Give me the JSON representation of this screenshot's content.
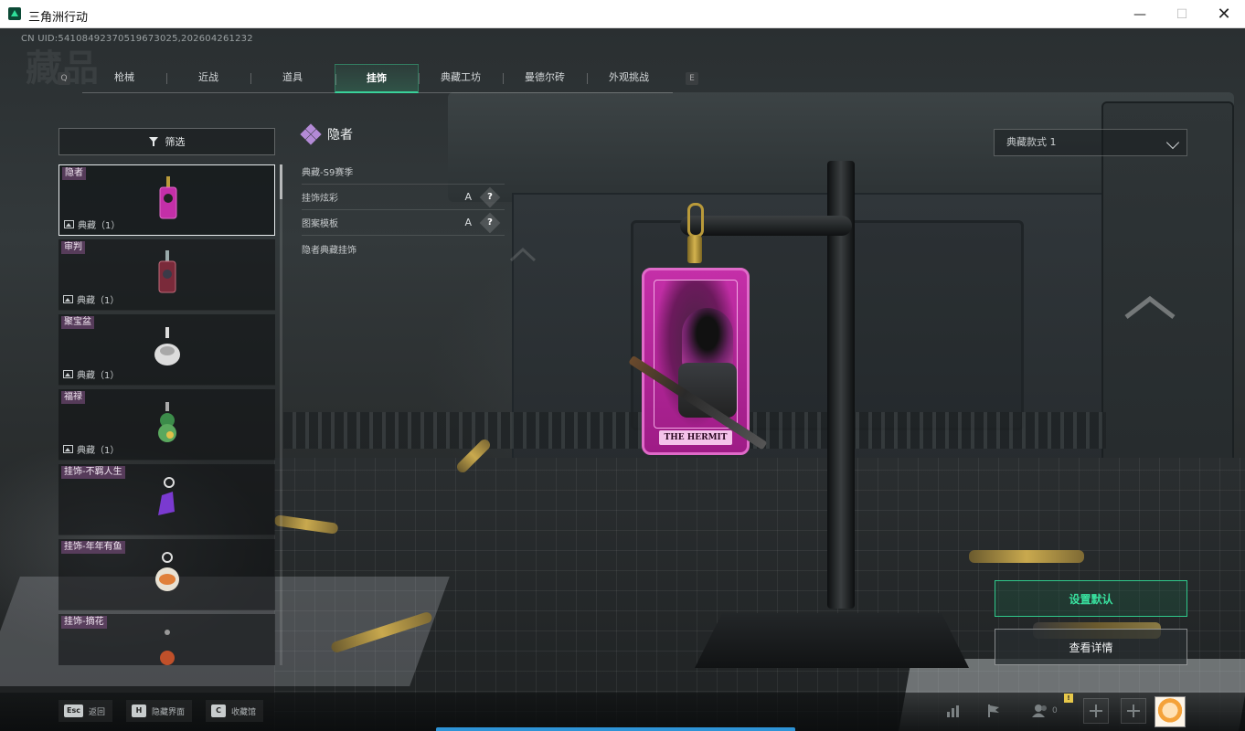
{
  "window": {
    "title": "三角洲行动",
    "minimize_glyph": "—",
    "maximize_glyph": "☐",
    "close_glyph": "✕"
  },
  "header": {
    "uid_text": "CN UID:5410849237051967302​5,202604261232",
    "watermark": "藏品",
    "key_prev": "Q",
    "key_next": "E"
  },
  "tabs": [
    {
      "label": "枪械",
      "active": false
    },
    {
      "label": "近战",
      "active": false
    },
    {
      "label": "道具",
      "active": false
    },
    {
      "label": "挂饰",
      "active": true
    },
    {
      "label": "典藏工坊",
      "active": false
    },
    {
      "label": "曼德尔砖",
      "active": false
    },
    {
      "label": "外观挑战",
      "active": false
    }
  ],
  "filter": {
    "label": "筛选",
    "icon": "filter-icon"
  },
  "items": [
    {
      "name": "隐者",
      "footer": "典藏（1）",
      "selected": true,
      "thumb_color": "#c42fa8"
    },
    {
      "name": "审判",
      "footer": "典藏（1）",
      "selected": false,
      "thumb_color": "#7a2a3a"
    },
    {
      "name": "聚宝盆",
      "footer": "典藏（1）",
      "selected": false,
      "thumb_color": "#d9d9d9"
    },
    {
      "name": "福禄",
      "footer": "典藏（1）",
      "selected": false,
      "thumb_color": "#3c8c4a"
    },
    {
      "name": "挂饰-不羁人生",
      "footer": "",
      "selected": false,
      "thumb_color": "#7a3ad0"
    },
    {
      "name": "挂饰-年年有鱼",
      "footer": "",
      "selected": false,
      "thumb_color": "#e0803a"
    },
    {
      "name": "挂饰-摘花",
      "footer": "",
      "selected": false,
      "thumb_color": "#c0502a"
    }
  ],
  "detail": {
    "title": "隐者",
    "title_icon": "diamond-cluster-icon",
    "season": "典藏-S9赛季",
    "rows": [
      {
        "label": "挂饰炫彩",
        "grade": "A",
        "help": "?"
      },
      {
        "label": "图案模板",
        "grade": "A",
        "help": "?"
      }
    ],
    "description": "隐者典藏挂饰"
  },
  "showcase": {
    "card_text": "THE HERMIT"
  },
  "style_select": {
    "value": "典藏款式 1"
  },
  "actions": {
    "set_default": "设置默认",
    "view_details": "查看详情"
  },
  "bottom_hints": [
    {
      "key": "Esc",
      "label": "返回"
    },
    {
      "key": "H",
      "label": "隐藏界面"
    },
    {
      "key": "C",
      "label": "收藏馆"
    }
  ],
  "tray": {
    "friends_count": "0",
    "notification_badge": "!",
    "icons": [
      "stats-icon",
      "flag-icon",
      "friends-icon",
      "plus-icon",
      "plus-icon",
      "avatar"
    ]
  },
  "colors": {
    "accent_green": "#39e3a0",
    "progress_blue": "#2e93d6",
    "card_magenta": "#c42fa8"
  }
}
